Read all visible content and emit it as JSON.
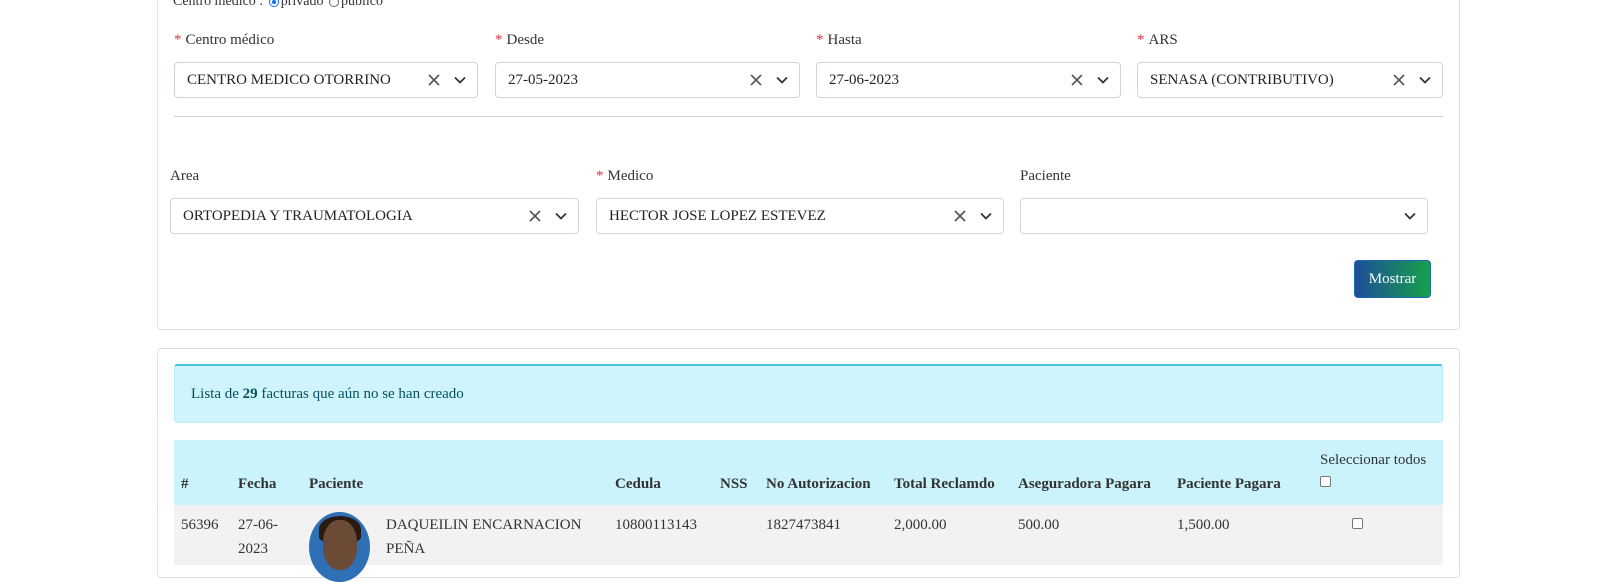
{
  "radio": {
    "label": "Centro médico :",
    "options": [
      "privado",
      "público"
    ],
    "selected": "privado"
  },
  "filters_row1": [
    {
      "label": "Centro médico",
      "required": true,
      "value": "CENTRO MEDICO OTORRINO"
    },
    {
      "label": "Desde",
      "required": true,
      "value": "27-05-2023"
    },
    {
      "label": "Hasta",
      "required": true,
      "value": "27-06-2023"
    },
    {
      "label": "ARS",
      "required": true,
      "value": "SENASA (CONTRIBUTIVO)"
    }
  ],
  "filters_row2": [
    {
      "label": "Area",
      "required": false,
      "value": "ORTOPEDIA Y TRAUMATOLOGIA"
    },
    {
      "label": "Medico",
      "required": true,
      "value": "HECTOR JOSE LOPEZ ESTEVEZ"
    },
    {
      "label": "Paciente",
      "required": false,
      "value": ""
    }
  ],
  "required_mark": "*",
  "show_button": "Mostrar",
  "alert": {
    "prefix": "Lista de",
    "count": "29",
    "suffix": "facturas que aún no se han creado"
  },
  "table": {
    "headers": [
      "#",
      "Fecha",
      "Paciente",
      "Cedula",
      "NSS",
      "No Autorizacion",
      "Total Reclamdo",
      "Aseguradora Pagara",
      "Paciente Pagara"
    ],
    "select_all": "Seleccionar todos",
    "rows": [
      {
        "id": "56396",
        "fecha_l1": "27-06-",
        "fecha_l2": "2023",
        "paciente_l1": "DAQUEILIN ENCARNACION",
        "paciente_l2": "PEÑA",
        "cedula": "10800113143",
        "nss": "",
        "autorizacion": "1827473841",
        "total": "2,000.00",
        "aseguradora": "500.00",
        "paciente_pagara": "1,500.00"
      }
    ]
  },
  "colors": {
    "required": "#dc3545",
    "alert_bg": "#cff4fc",
    "header_bg": "#caf3fc",
    "button_from": "#1d4e99",
    "button_to": "#16a14a"
  }
}
